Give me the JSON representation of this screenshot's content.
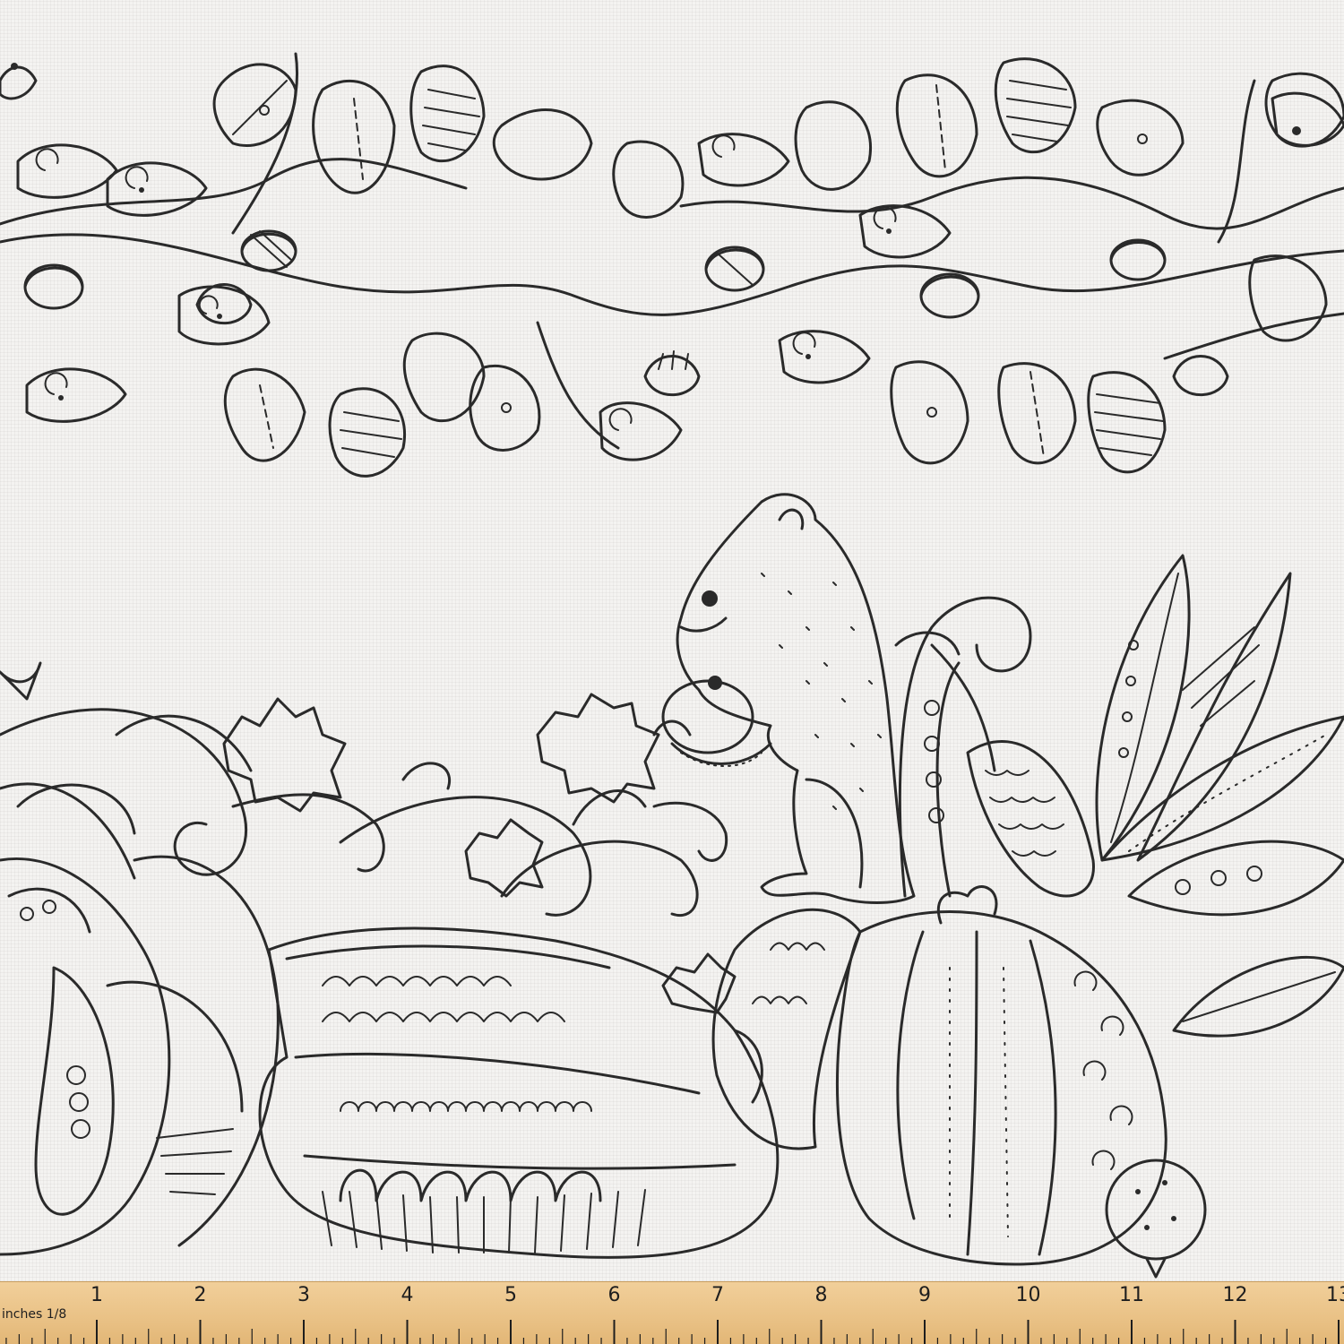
{
  "artwork": {
    "colors": {
      "ink": "#2a2a2a",
      "paper": "#f4f3f1",
      "ruler_wood": "#ebc487",
      "ruler_text": "#1e1e1e"
    },
    "icons": [
      "squirrel-icon",
      "acorn-icon",
      "leaf-icon",
      "pumpkin-icon",
      "squash-icon",
      "grape-leaf-icon",
      "vine-swirl-icon"
    ]
  },
  "ruler": {
    "numbers": [
      "1",
      "2",
      "3",
      "4",
      "5",
      "6",
      "7",
      "8",
      "9",
      "10",
      "11",
      "12",
      "13"
    ],
    "unit_label": "inches 1/8"
  }
}
